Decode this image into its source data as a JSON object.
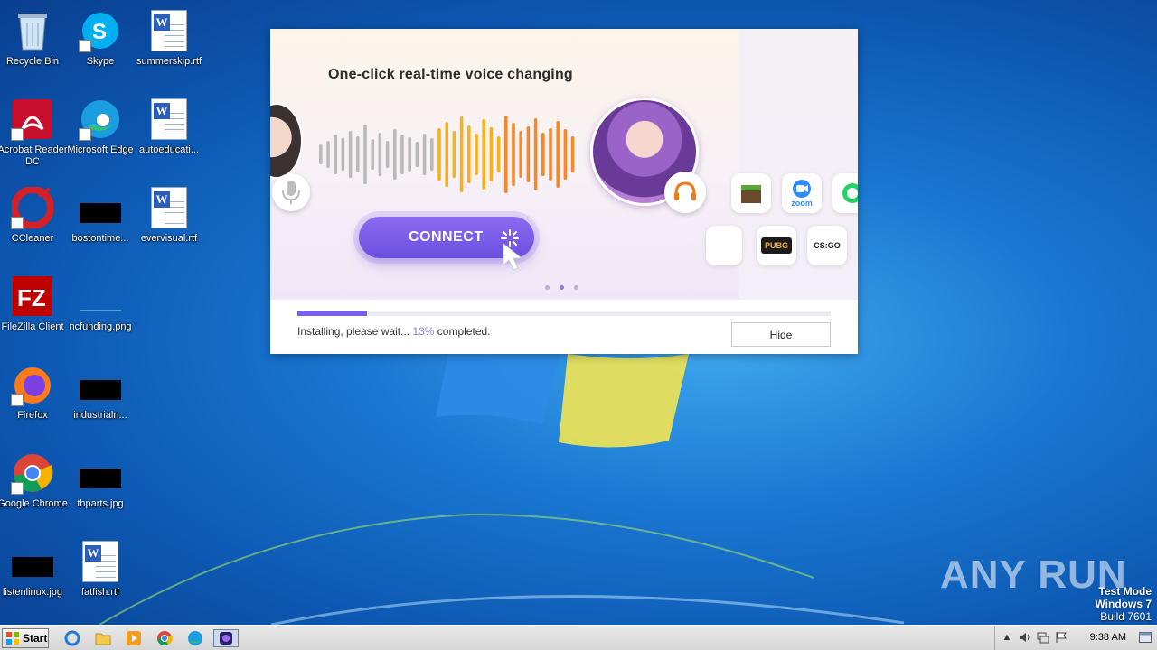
{
  "desktop": {
    "icons": [
      {
        "label": "Recycle Bin"
      },
      {
        "label": "Skype"
      },
      {
        "label": "summerskip.rtf"
      },
      {
        "label": "Acrobat Reader DC"
      },
      {
        "label": "Microsoft Edge"
      },
      {
        "label": "autoeducati..."
      },
      {
        "label": "CCleaner"
      },
      {
        "label": "bostontime..."
      },
      {
        "label": "evervisual.rtf"
      },
      {
        "label": "FileZilla Client"
      },
      {
        "label": "ncfunding.png"
      },
      {
        "label": "Firefox"
      },
      {
        "label": "industrialn..."
      },
      {
        "label": "Google Chrome"
      },
      {
        "label": "thparts.jpg"
      },
      {
        "label": "listenlinux.jpg"
      },
      {
        "label": "fatfish.rtf"
      }
    ]
  },
  "installer": {
    "banner_title": "One-click real-time voice changing",
    "connect_label": "CONNECT",
    "apps": [
      {
        "name": "minecraft",
        "label": ""
      },
      {
        "name": "zoom",
        "label": "zoom"
      },
      {
        "name": "whatsapp",
        "label": ""
      },
      {
        "name": "pubg",
        "label": "PUBG"
      },
      {
        "name": "csgo",
        "label": "CS:GO"
      }
    ],
    "carousel": {
      "count": 3,
      "active_index": 1
    },
    "progress": {
      "percent": 13,
      "status_prefix": "Installing, please wait...",
      "percent_text": "13%",
      "status_suffix": "completed."
    },
    "hide_label": "Hide"
  },
  "watermark": {
    "text": "ANY RUN"
  },
  "windows_info": {
    "line1": "Test Mode",
    "line2": "Windows 7",
    "line3": "Build 7601"
  },
  "taskbar": {
    "start_label": "Start",
    "clock": "9:38 AM"
  },
  "colors": {
    "accent": "#7a5fe8",
    "desktop_bg": "#1a78d2"
  }
}
